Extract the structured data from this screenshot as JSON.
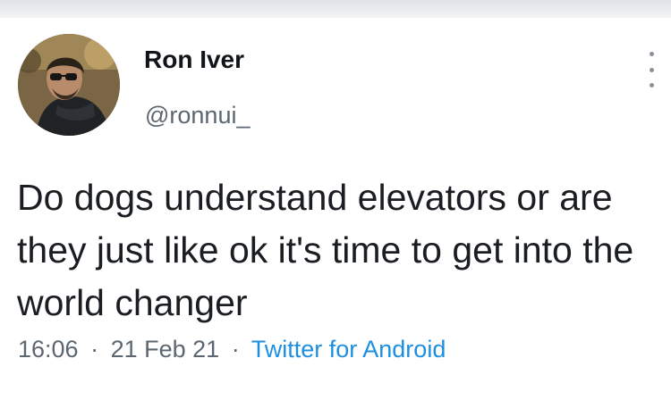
{
  "tweet": {
    "author": {
      "display_name": "Ron Iver",
      "handle": "@ronnui_"
    },
    "text": "Do dogs understand elevators or are they just like ok it's time to get into the world changer",
    "time": "16:06",
    "date": "21 Feb 21",
    "client": "Twitter for Android",
    "separator": "·",
    "more_icon": "more-vertical-icon",
    "colors": {
      "text": "#1a1d21",
      "secondary": "#5b6670",
      "link": "#1d8fe0"
    }
  }
}
